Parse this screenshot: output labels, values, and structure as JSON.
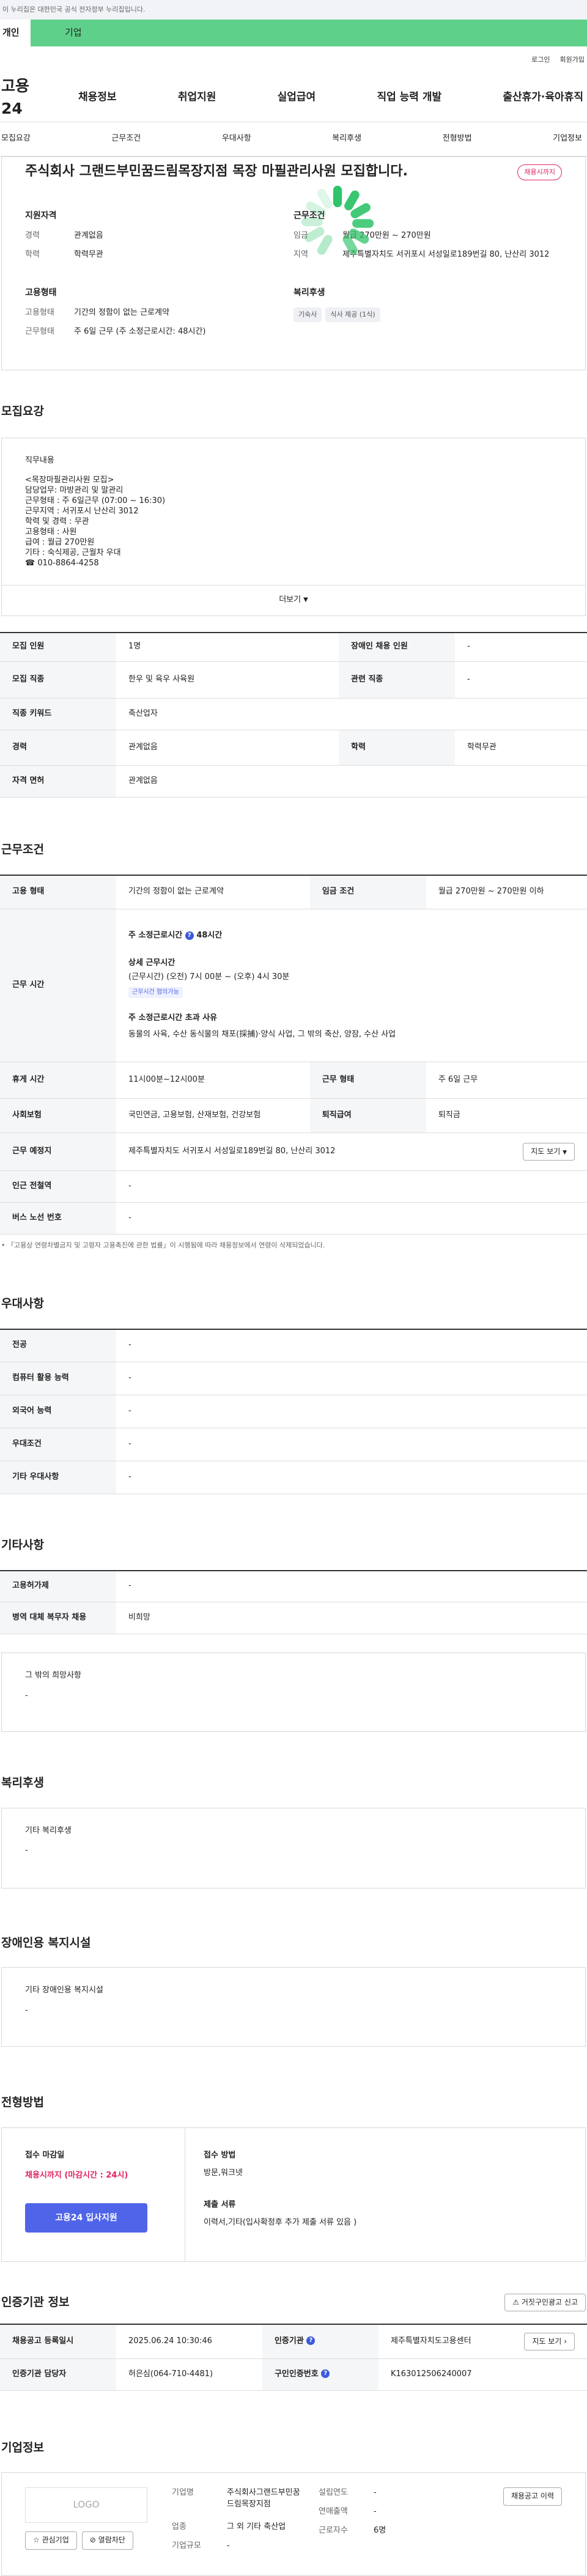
{
  "gov_banner": "이 누리집은 대한민국 공식 전자정부 누리집입니다.",
  "user_tabs": [
    "개인",
    "기업"
  ],
  "util": [
    "로그인",
    "회원가입"
  ],
  "logo": "고용24",
  "gnb": [
    "채용정보",
    "취업지원",
    "실업급여",
    "직업 능력 개발",
    "출산휴가·육아휴직"
  ],
  "anchors": [
    "모집요강",
    "근무조건",
    "우대사항",
    "복리후생",
    "전형방법",
    "기업정보"
  ],
  "title": "주식회사 그랜드부민꿈드림목장지점 목장 마필관리사원 모집합니다.",
  "deadline_badge": "채용시까지",
  "summary": {
    "left_h": "지원자격",
    "left": [
      {
        "k": "경력",
        "v": "관계없음"
      },
      {
        "k": "학력",
        "v": "학력무관"
      }
    ],
    "right_h": "근무조건",
    "right": [
      {
        "k": "임금",
        "v": "월급 270만원 ~ 270만원"
      },
      {
        "k": "지역",
        "v": "제주특별자치도 서귀포시 서성일로189번길 80, 난산리 3012"
      }
    ],
    "emp_h": "고용형태",
    "emp": [
      {
        "k": "고용형태",
        "v": "기간의 정함이 없는 근로계약"
      },
      {
        "k": "근무형태",
        "v": "주 6일 근무 (주 소정근로시간: 48시간)"
      }
    ],
    "wel_h": "복리후생",
    "wel_chips": [
      "기숙사",
      "식사 제공 (1식)"
    ]
  },
  "recruit": {
    "heading": "모집요강",
    "duty_h": "직무내용",
    "duty_lines": [
      "<목장마필관리사원 모집>",
      "담당업무: 마방관리 및 말관리",
      "근무형태 : 주 6일근무 (07:00 ~ 16:30)",
      "근무지역 : 서귀포시 난산리 3012",
      "학력 및 경력 : 무관",
      "고용형태 : 사원",
      "급여 : 월급 270만원",
      "기타 : 숙식제공, 근월차 우대",
      "☎ 010-8864-4258"
    ],
    "more": "더보기",
    "rows": [
      {
        "k": "모집 인원",
        "v": "1명",
        "k2": "장애인 채용 인원",
        "v2": "-"
      },
      {
        "k": "모집 직종",
        "v": "한우 및 육우 사육원",
        "k2": "관련 직종",
        "v2": "-"
      },
      {
        "k": "직종 키워드",
        "v": "축산업자"
      },
      {
        "k": "경력",
        "v": "관계없음",
        "k2": "학력",
        "v2": "학력무관"
      },
      {
        "k": "자격 면허",
        "v": "관계없음"
      }
    ]
  },
  "cond": {
    "heading": "근무조건",
    "emp_type_k": "고용 형태",
    "emp_type_v": "기간의 정함이 없는 근로계약",
    "wage_k": "임금 조건",
    "wage_v": "월급 270만원 ~ 270만원 이하",
    "hours_k": "근무 시간",
    "hours_main": "주 소정근로시간",
    "hours_main_v": "48시간",
    "detail_h": "상세 근무시간",
    "detail_v": "(근무시간) (오전) 7시 00분 ~ (오후) 4시 30분",
    "detail_badge": "근무시간 협의가능",
    "over_h": "주 소정근로시간 초과 사유",
    "over_v": "동물의 사육, 수산 동식물의 채포(採捕)·양식 사업, 그 밖의 축산, 양잠, 수산 사업",
    "break_k": "휴게 시간",
    "break_v": "11시00분~12시00분",
    "worktype_k": "근무 형태",
    "worktype_v": "주 6일 근무",
    "ins_k": "사회보험",
    "ins_v": "국민연금, 고용보험, 산재보험, 건강보험",
    "ret_k": "퇴직급여",
    "ret_v": "퇴직금",
    "place_k": "근무 예정지",
    "place_v": "제주특별자치도 서귀포시 서성일로189번길 80, 난산리 3012",
    "map_btn": "지도 보기",
    "subway_k": "인근 전철역",
    "subway_v": "-",
    "bus_k": "버스 노선 번호",
    "bus_v": "-",
    "note": "「고용상 연령차별금지 및 고령자 고용촉진에 관한 법률」이 시행됨에 따라 채용정보에서 연령이 삭제되었습니다."
  },
  "pref": {
    "heading": "우대사항",
    "rows": [
      {
        "k": "전공",
        "v": "-"
      },
      {
        "k": "컴퓨터 활용 능력",
        "v": "-"
      },
      {
        "k": "외국어 능력",
        "v": "-"
      },
      {
        "k": "우대조건",
        "v": "-"
      },
      {
        "k": "기타 우대사항",
        "v": "-"
      }
    ]
  },
  "etc": {
    "heading": "기타사항",
    "rows": [
      {
        "k": "고용허가제",
        "v": "-"
      },
      {
        "k": "병역 대체 복무자 채용",
        "v": "비희망"
      }
    ],
    "box_h": "그 밖의 희망사항",
    "box_v": "-"
  },
  "welfare": {
    "heading": "복리후생",
    "box_h": "기타 복리후생",
    "box_v": "-"
  },
  "disab": {
    "heading": "장애인용 복지시설",
    "box_h": "기타 장애인용 복지시설",
    "box_v": "-"
  },
  "select": {
    "heading": "전형방법",
    "deadline_h": "접수 마감일",
    "deadline_v": "채용시까지 (마감시간 : 24시)",
    "apply_btn": "고용24 입사지원",
    "method_h": "접수 방법",
    "method_v": "방문,워크넷",
    "docs_h": "제출 서류",
    "docs_v": "이력서,기타(입사확정후 추가 제출 서류 있음 )"
  },
  "cert": {
    "heading": "인증기관 정보",
    "report_btn": "거짓구인광고 신고",
    "reg_k": "채용공고 등록일시",
    "reg_v": "2025.06.24 10:30:46",
    "org_k": "인증기관",
    "org_v": "제주특별자치도고용센터",
    "map_btn": "지도 보기",
    "mgr_k": "인증기관 담당자",
    "mgr_v": "허은심(064-710-4481)",
    "no_k": "구인인증번호",
    "no_v": "K163012506240007"
  },
  "company": {
    "heading": "기업정보",
    "logo": "LOGO",
    "fav_btn": "관심기업",
    "block_btn": "열람차단",
    "name_k": "기업명",
    "name_v": "주식회사그랜드부민꿈드림목장지점",
    "industry_k": "업종",
    "industry_v": "그 외 기타 축산업",
    "size_k": "기업규모",
    "size_v": "-",
    "founded_k": "설립연도",
    "founded_v": "-",
    "sales_k": "연매출액",
    "sales_v": "-",
    "staff_k": "근로자수",
    "staff_v": "6명",
    "history_btn": "채용공고 이력"
  }
}
